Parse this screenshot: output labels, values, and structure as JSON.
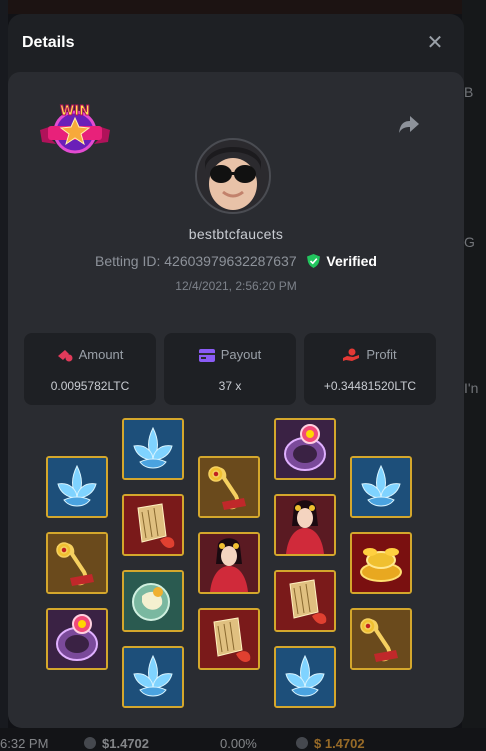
{
  "modal": {
    "title": "Details",
    "close_label": "✕"
  },
  "bet": {
    "badge_text": "WIN",
    "username": "bestbtcfaucets",
    "betting_id_label": "Betting ID:",
    "betting_id": "42603979632287637",
    "verified_label": "Verified",
    "date": "12/4/2021, 2:56:20 PM"
  },
  "stats": [
    {
      "label": "Amount",
      "value": "0.0095782LTC",
      "icon": "coins-icon",
      "color": "#e23a5a"
    },
    {
      "label": "Payout",
      "value": "37 x",
      "icon": "card-icon",
      "color": "#8b5cf6"
    },
    {
      "label": "Profit",
      "value": "+0.34481520LTC",
      "icon": "hand-coin-icon",
      "color": "#e53935"
    }
  ],
  "reels": [
    [
      "lotus",
      "scroll",
      "ring"
    ],
    [
      "lotus",
      "lute",
      "jade",
      "lotus"
    ],
    [
      "scroll",
      "dancer",
      "lute"
    ],
    [
      "ring",
      "dancer",
      "lute",
      "lotus"
    ],
    [
      "lotus",
      "gold",
      "scroll"
    ]
  ],
  "background": {
    "right_texts": [
      "B",
      "G",
      "I'n"
    ],
    "bottom_time": "6:32 PM",
    "bottom_amount_1": "$1.4702",
    "bottom_percent": "0.00%",
    "bottom_amount_2": "$ 1.4702"
  },
  "colors": {
    "modal_bg": "#1e2024",
    "card_bg": "#2a2c31",
    "tile_border": "#d4a72c",
    "verified_green": "#22c55e"
  }
}
